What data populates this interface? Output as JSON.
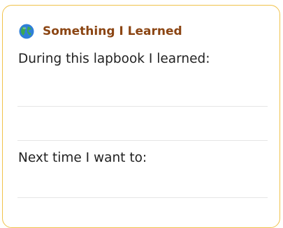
{
  "card": {
    "icon": "globe-icon",
    "title": "Something I Learned",
    "prompt_learned": "During this lapbook I learned:",
    "prompt_next": "Next time I want to:",
    "border_color": "#f0c24a",
    "title_color": "#8b4513"
  }
}
